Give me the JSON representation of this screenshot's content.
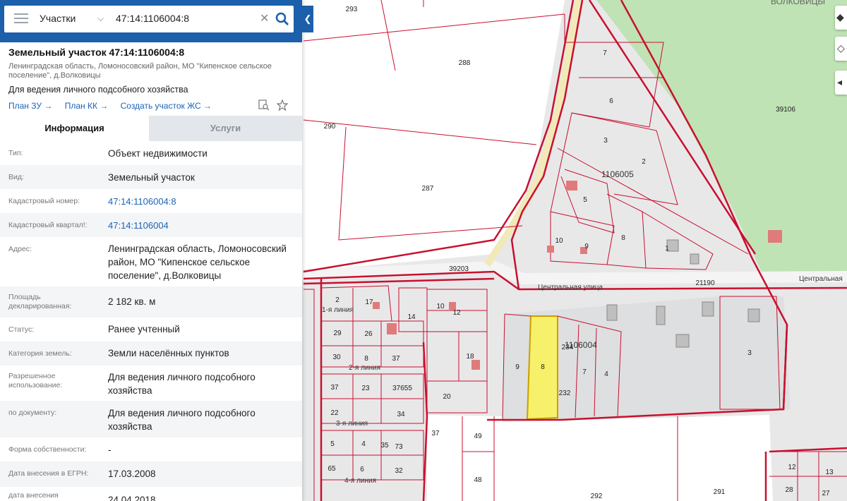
{
  "search": {
    "selector_label": "Участки",
    "query": "47:14:1106004:8"
  },
  "object": {
    "title": "Земельный участок 47:14:1106004:8",
    "address_short": "Ленинградская область, Ломоносовский район, МО \"Кипенское сельское поселение\", д.Волковицы",
    "purpose": "Для ведения личного подсобного хозяйства",
    "links": [
      "План ЗУ →",
      "План КК →",
      "Создать участок ЖС →"
    ]
  },
  "tabs": [
    "Информация",
    "Услуги"
  ],
  "info_rows": [
    {
      "label": "Тип:",
      "value": "Объект недвижимости"
    },
    {
      "label": "Вид:",
      "value": "Земельный участок"
    },
    {
      "label": "Кадастровый номер:",
      "value": "47:14:1106004:8"
    },
    {
      "label": "Кадастровый квартал!:",
      "value": "47:14:1106004"
    },
    {
      "label": "Адрес:",
      "value": "Ленинградская область, Ломоносовский район, МО \"Кипенское сельское поселение\", д.Волковицы"
    },
    {
      "label": "Площадь декларированная:",
      "value": "2 182 кв. м"
    },
    {
      "label": "Статус:",
      "value": "Ранее учтенный"
    },
    {
      "label": "Категория земель:",
      "value": "Земли населённых пунктов"
    },
    {
      "label": "Разрешенное использование:",
      "value": "Для ведения личного подсобного хозяйства"
    },
    {
      "label": "по документу:",
      "value": "Для ведения личного подсобного хозяйства"
    },
    {
      "label": "Форма собственности:",
      "value": "-"
    },
    {
      "label": "Дата внесения в ЕГРН:",
      "value": "17.03.2008"
    },
    {
      "label": "дата внесения",
      "value": "24.04.2018"
    }
  ],
  "map": {
    "village_label": "ВОЛКОВИЦЫ",
    "streets": [
      "Центральная улица",
      "Центральная",
      "1-я линия",
      "2-я линия",
      "3-я линия",
      "4-я линия"
    ],
    "quarters": [
      "1106005",
      "1106004"
    ],
    "parcel_labels": [
      "293",
      "288",
      "290",
      "287",
      "39106",
      "7",
      "6",
      "3",
      "2",
      "5",
      "14",
      "10",
      "9",
      "8",
      "1",
      "39203",
      "21190",
      "2",
      "17",
      "14",
      "10",
      "12",
      "29",
      "26",
      "30",
      "8",
      "37",
      "18",
      "37",
      "23",
      "37655",
      "22",
      "34",
      "20",
      "5",
      "4",
      "35",
      "73",
      "37",
      "49",
      "65",
      "6",
      "32",
      "48",
      "9",
      "8",
      "234",
      "7",
      "4",
      "232",
      "3",
      "292",
      "291",
      "12",
      "13",
      "28",
      "27"
    ],
    "highlight_color": "#f7f06a",
    "boundary_color": "#c8102e",
    "forest_color": "#bfe3b4"
  },
  "colors": {
    "header": "#1c5faa",
    "link": "#1a64b8"
  }
}
